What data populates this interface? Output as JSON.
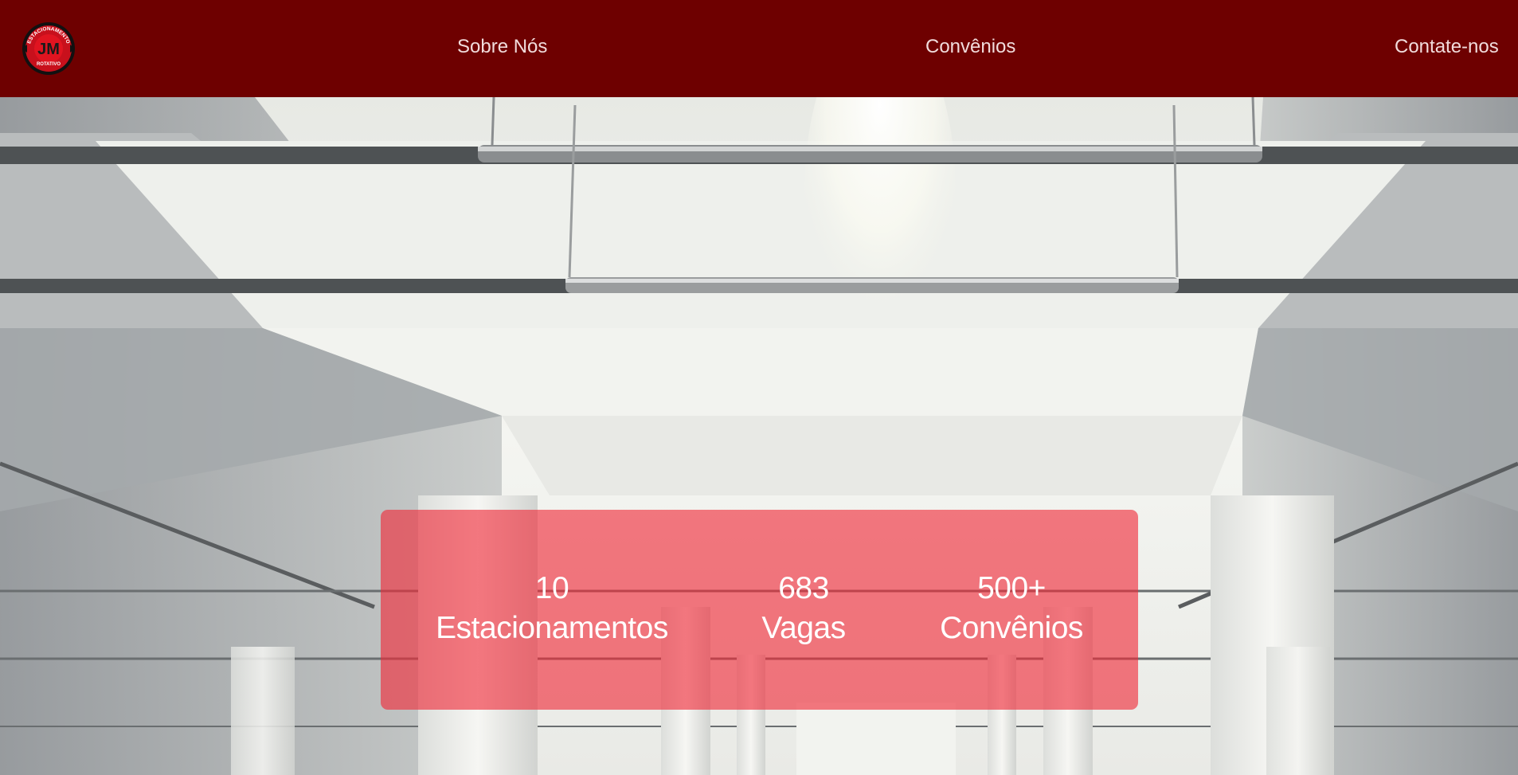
{
  "brand": {
    "logo_icon": "jm-estacionamento-rotativo-logo",
    "logo_top_text": "ESTACIONAMENTO",
    "logo_initials": "JM",
    "logo_bottom_text": "ROTATIVO"
  },
  "nav": {
    "items": [
      {
        "label": "Sobre Nós"
      },
      {
        "label": "Convênios"
      },
      {
        "label": "Contate-nos"
      }
    ]
  },
  "hero": {
    "image_icon": "parking-garage-photo"
  },
  "stats": [
    {
      "number": "10",
      "label": "Estacionamentos"
    },
    {
      "number": "683",
      "label": "Vagas"
    },
    {
      "number": "500+",
      "label": "Convênios"
    }
  ],
  "colors": {
    "navbar_bg": "#6e0000",
    "nav_text": "#f1dcdc",
    "stats_overlay": "#f02837",
    "stats_text": "#ffffff"
  }
}
